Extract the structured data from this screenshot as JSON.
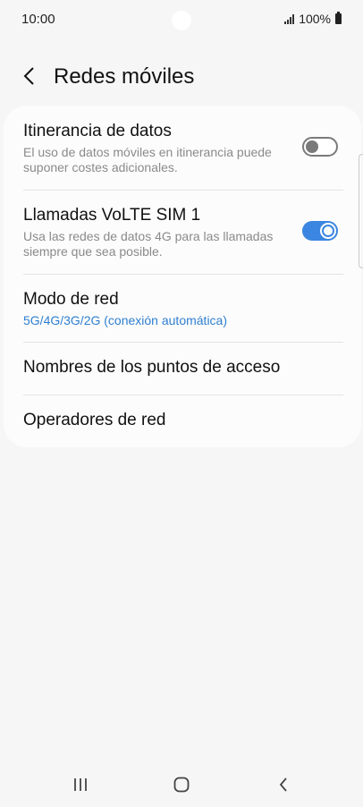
{
  "status_bar": {
    "time": "10:00",
    "battery": "100%",
    "icons": [
      "signal-icon",
      "battery-icon"
    ]
  },
  "header": {
    "title": "Redes móviles",
    "back_icon": "chevron-left-icon"
  },
  "settings": {
    "items": [
      {
        "title": "Itinerancia de datos",
        "subtitle": "El uso de datos móviles en itinerancia puede suponer costes adicionales.",
        "toggle": "off"
      },
      {
        "title": "Llamadas VoLTE SIM 1",
        "subtitle": "Usa las redes de datos 4G para las llamadas siempre que sea posible.",
        "toggle": "on"
      },
      {
        "title": "Modo de red",
        "value": "5G/4G/3G/2G (conexión automática)"
      },
      {
        "title": "Nombres de los puntos de acceso"
      },
      {
        "title": "Operadores de red"
      }
    ]
  },
  "nav_bar": {
    "icons": [
      "recent-apps-icon",
      "home-icon",
      "back-icon"
    ]
  },
  "colors": {
    "accent": "#3a86e0",
    "link": "#2f7fd1",
    "background": "#f6f6f6",
    "card": "#fcfcfc"
  }
}
